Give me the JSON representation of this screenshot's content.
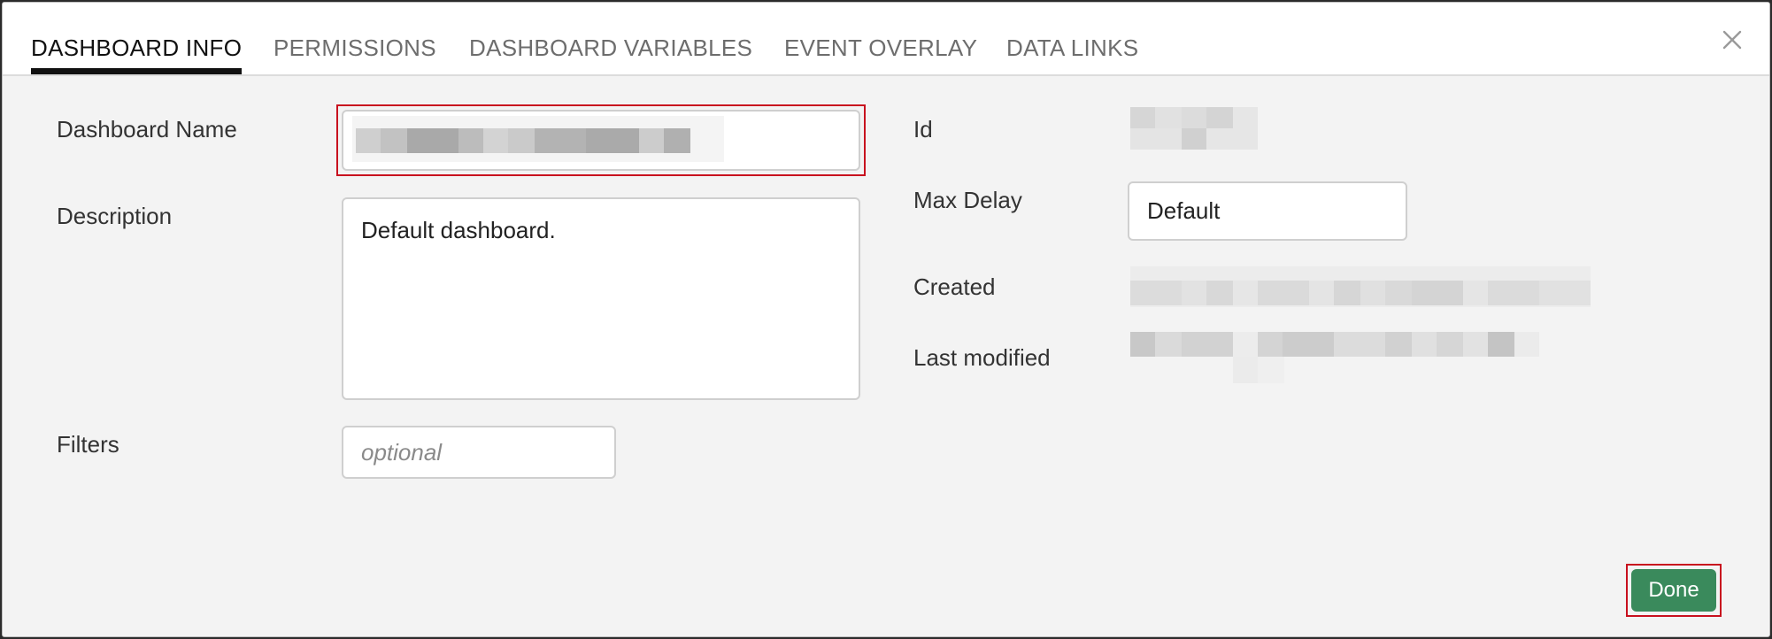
{
  "tabs": [
    {
      "label": "DASHBOARD INFO",
      "active": true
    },
    {
      "label": "PERMISSIONS",
      "active": false
    },
    {
      "label": "DASHBOARD VARIABLES",
      "active": false
    },
    {
      "label": "EVENT OVERLAY",
      "active": false
    },
    {
      "label": "DATA LINKS",
      "active": false
    }
  ],
  "close_icon": "close-icon",
  "form": {
    "dashboard_name": {
      "label": "Dashboard Name",
      "value": ""
    },
    "description": {
      "label": "Description",
      "value": "Default dashboard."
    },
    "filters": {
      "label": "Filters",
      "placeholder": "optional"
    }
  },
  "meta": {
    "id": {
      "label": "Id"
    },
    "max_delay": {
      "label": "Max Delay",
      "value": "Default"
    },
    "created": {
      "label": "Created"
    },
    "last_modified": {
      "label": "Last modified"
    }
  },
  "done_label": "Done",
  "colors": {
    "accent": "#3a8a5c",
    "highlight": "#c8101e"
  }
}
